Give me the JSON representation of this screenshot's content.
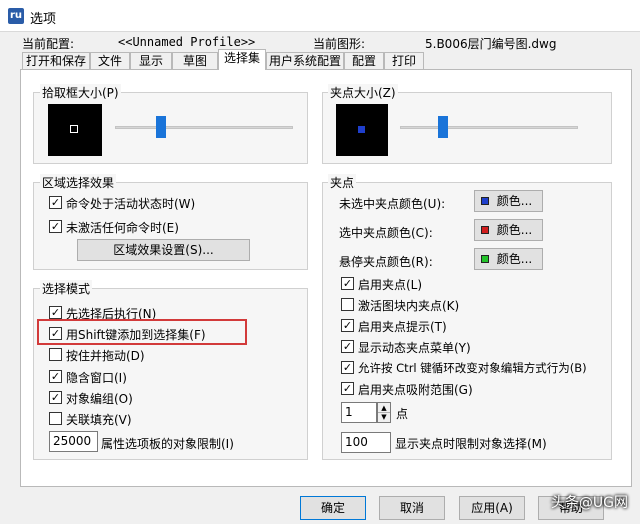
{
  "window": {
    "title": "选项",
    "app_icon_text": "ru"
  },
  "header": {
    "current_profile_label": "当前配置:",
    "current_profile_value": "<<Unnamed Profile>>",
    "current_drawing_label": "当前图形:",
    "current_drawing_value": "5.B006层门编号图.dwg"
  },
  "tabs": [
    "打开和保存",
    "文件",
    "显示",
    "草图",
    "选择集",
    "用户系统配置",
    "配置",
    "打印"
  ],
  "active_tab": "选择集",
  "pickbox": {
    "title": "拾取框大小(P)",
    "slider_percent": 26
  },
  "grip_size": {
    "title": "夹点大小(Z)",
    "slider_percent": 24
  },
  "area_selection": {
    "title": "区域选择效果",
    "items": [
      {
        "label": "命令处于活动状态时(W)",
        "checked": true
      },
      {
        "label": "未激活任何命令时(E)",
        "checked": true
      }
    ],
    "settings_button": "区域效果设置(S)..."
  },
  "selection_mode": {
    "title": "选择模式",
    "items": [
      {
        "label": "先选择后执行(N)",
        "checked": true
      },
      {
        "label": "用Shift键添加到选择集(F)",
        "checked": true
      },
      {
        "label": "按住并拖动(D)",
        "checked": false
      },
      {
        "label": "隐含窗口(I)",
        "checked": true
      },
      {
        "label": "对象编组(O)",
        "checked": true
      },
      {
        "label": "关联填充(V)",
        "checked": false
      }
    ],
    "limit_value": "25000",
    "limit_label": "属性选项板的对象限制(I)"
  },
  "grips": {
    "title": "夹点",
    "colors": [
      {
        "label": "未选中夹点颜色(U):",
        "button": "颜色...",
        "color": "#1f3fcc"
      },
      {
        "label": "选中夹点颜色(C):",
        "button": "颜色...",
        "color": "#d01d1d"
      },
      {
        "label": "悬停夹点颜色(R):",
        "button": "颜色...",
        "color": "#22c22a"
      }
    ],
    "items": [
      {
        "label": "启用夹点(L)",
        "checked": true
      },
      {
        "label": "激活图块内夹点(K)",
        "checked": false
      },
      {
        "label": "启用夹点提示(T)",
        "checked": true
      },
      {
        "label": "显示动态夹点菜单(Y)",
        "checked": true
      },
      {
        "label": "允许按 Ctrl 键循环改变对象编辑方式行为(B)",
        "checked": true
      },
      {
        "label": "启用夹点吸附范围(G)",
        "checked": true
      }
    ],
    "snap_value": "1",
    "snap_unit": "点",
    "limit_value": "100",
    "limit_label": "显示夹点时限制对象选择(M)"
  },
  "buttons": {
    "ok": "确定",
    "cancel": "取消",
    "apply": "应用(A)",
    "help": "帮助"
  },
  "watermark": "头条@UG网"
}
